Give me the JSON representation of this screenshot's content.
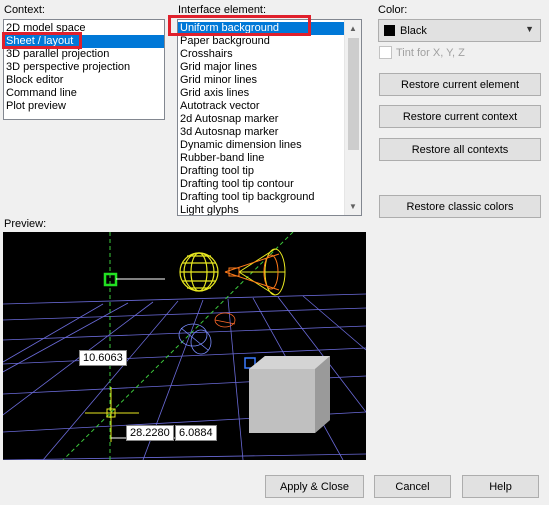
{
  "labels": {
    "context": "Context:",
    "interface_element": "Interface element:",
    "color": "Color:",
    "preview": "Preview:",
    "tint": "Tint for X, Y, Z"
  },
  "context_items": [
    {
      "label": "2D model space",
      "selected": false
    },
    {
      "label": "Sheet / layout",
      "selected": true
    },
    {
      "label": "3D parallel projection",
      "selected": false
    },
    {
      "label": "3D perspective projection",
      "selected": false
    },
    {
      "label": "Block editor",
      "selected": false
    },
    {
      "label": "Command line",
      "selected": false
    },
    {
      "label": "Plot preview",
      "selected": false
    }
  ],
  "interface_items": [
    {
      "label": "Uniform background",
      "selected": true
    },
    {
      "label": "Paper background",
      "selected": false
    },
    {
      "label": "Crosshairs",
      "selected": false
    },
    {
      "label": "Grid major lines",
      "selected": false
    },
    {
      "label": "Grid minor lines",
      "selected": false
    },
    {
      "label": "Grid axis lines",
      "selected": false
    },
    {
      "label": "Autotrack vector",
      "selected": false
    },
    {
      "label": "2d Autosnap marker",
      "selected": false
    },
    {
      "label": "3d Autosnap marker",
      "selected": false
    },
    {
      "label": "Dynamic dimension lines",
      "selected": false
    },
    {
      "label": "Rubber-band line",
      "selected": false
    },
    {
      "label": "Drafting tool tip",
      "selected": false
    },
    {
      "label": "Drafting tool tip contour",
      "selected": false
    },
    {
      "label": "Drafting tool tip background",
      "selected": false
    },
    {
      "label": "Light glyphs",
      "selected": false
    }
  ],
  "color": {
    "value": "Black",
    "swatch": "#000000"
  },
  "buttons": {
    "restore_element": "Restore current element",
    "restore_context": "Restore current context",
    "restore_all": "Restore all contexts",
    "restore_classic": "Restore classic colors",
    "apply_close": "Apply & Close",
    "cancel": "Cancel",
    "help": "Help"
  },
  "preview": {
    "dim1": "10.6063",
    "dim2": "28.2280",
    "dim3": "6.0884"
  },
  "colors": {
    "selection": "#0078d7",
    "highlight": "#e0202c",
    "grid": "#6a6ad8",
    "preview_bg": "#000000"
  }
}
